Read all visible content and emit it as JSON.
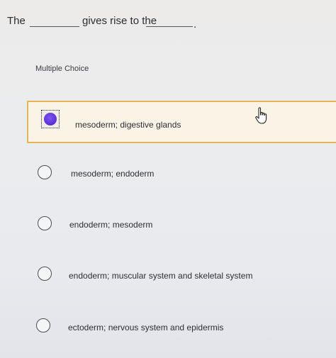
{
  "question": {
    "word1": "The",
    "word2": "gives rise to the",
    "end": "."
  },
  "section_label": "Multiple Choice",
  "options": [
    {
      "text": "mesoderm; digestive glands",
      "selected": true
    },
    {
      "text": "mesoderm; endoderm",
      "selected": false
    },
    {
      "text": "endoderm; mesoderm",
      "selected": false
    },
    {
      "text": "endoderm; muscular system and skeletal system",
      "selected": false
    },
    {
      "text": "ectoderm; nervous system and epidermis",
      "selected": false
    }
  ],
  "colors": {
    "selected_border": "#e9b35a",
    "selected_bg": "#fbf4e6",
    "radio_fill": "#5b2bd8"
  }
}
